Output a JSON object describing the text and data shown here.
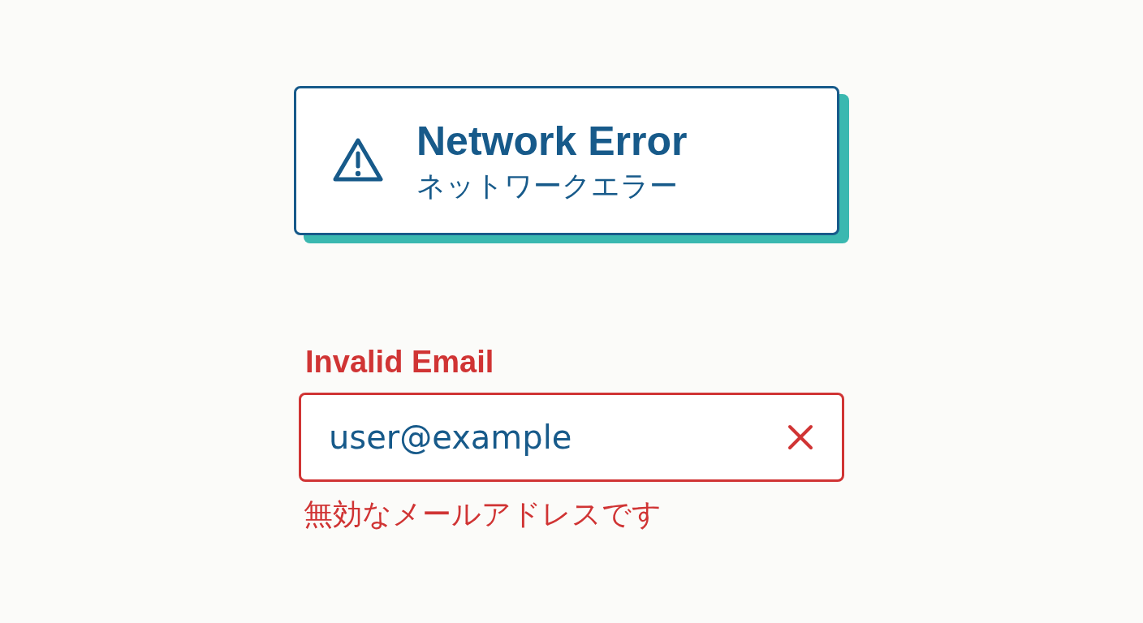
{
  "error_card": {
    "title": "Network Error",
    "subtitle": "ネットワークエラー"
  },
  "email_field": {
    "label": "Invalid Email",
    "value": "user@example",
    "invalid": true,
    "error_message": "無効なメールアドレスです"
  }
}
